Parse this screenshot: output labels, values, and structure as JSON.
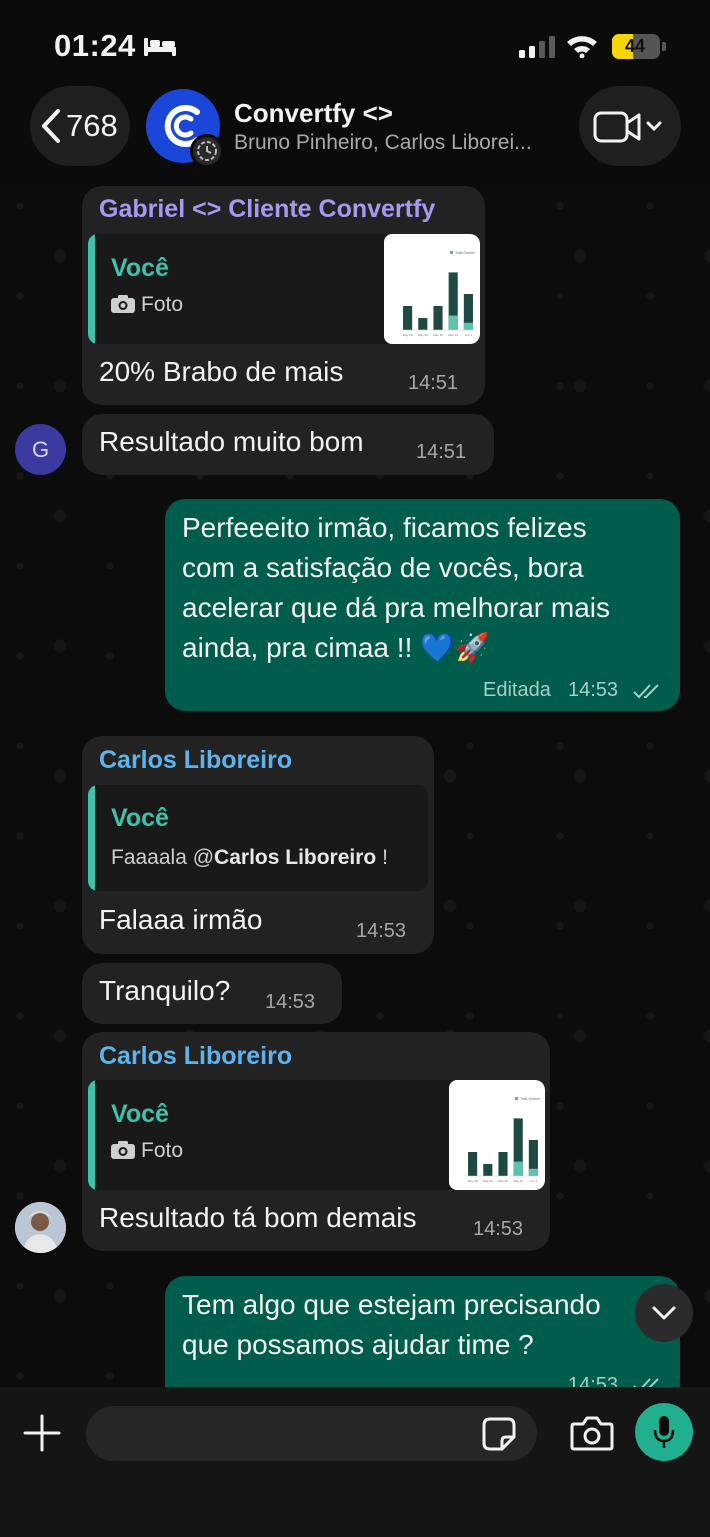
{
  "status_bar": {
    "time": "01:24",
    "battery_level": "44",
    "battery_color": "#f5d60a"
  },
  "header": {
    "back_count": "768",
    "title": "Convertfy <>",
    "subtitle": "Bruno Pinheiro, Carlos Liborei...",
    "icons": [
      "chevron-left-icon",
      "convertfy-logo",
      "video-call-icon",
      "chevron-down-icon"
    ]
  },
  "messages": [
    {
      "sender": "Gabriel <> Cliente Convertfy",
      "sender_color": "#a49af0",
      "quote_author": "Você",
      "quote_text": "Foto",
      "text": "20% Brabo de mais",
      "time": "14:51"
    },
    {
      "avatar_initial": "G",
      "text": "Resultado muito bom",
      "time": "14:51"
    },
    {
      "outgoing": true,
      "lines": [
        "Perfeeeito irmão, ficamos felizes",
        "com a satisfação de vocês, bora",
        "acelerar que dá pra melhorar mais",
        "ainda, pra cimaa !! 💙🚀"
      ],
      "edited": "Editada",
      "time": "14:53"
    },
    {
      "sender": "Carlos Liboreiro",
      "sender_color": "#5fb3ea",
      "quote_author": "Você",
      "quote_prefix": "Faaaala @",
      "quote_mention": "Carlos Liboreiro",
      "quote_suffix": " !",
      "text": "Falaaa irmão",
      "time": "14:53"
    },
    {
      "text": "Tranquilo?",
      "time": "14:53"
    },
    {
      "sender": "Carlos Liboreiro",
      "quote_author": "Você",
      "quote_text": "Foto",
      "text": "Resultado tá bom demais",
      "time": "14:53"
    },
    {
      "outgoing": true,
      "lines": [
        "Tem algo que estejam precisando",
        "que possamos ajudar time ?"
      ],
      "time": "14:53"
    }
  ],
  "thumbnail_chart": {
    "legend": "Total Ombrel",
    "categories": [
      "May 28",
      "May 29",
      "May 30",
      "May 31",
      "Jun 1"
    ],
    "values": [
      1.0,
      0.5,
      1.0,
      2.4,
      1.5
    ],
    "highlight": [
      0,
      0,
      0,
      0.6,
      0.3
    ],
    "ylim": [
      0,
      3.0
    ]
  },
  "colors": {
    "accent": "#3fc2aa",
    "outgoing_bubble": "#005c4b",
    "incoming_bubble": "#222223",
    "mic_button": "#20b090"
  }
}
